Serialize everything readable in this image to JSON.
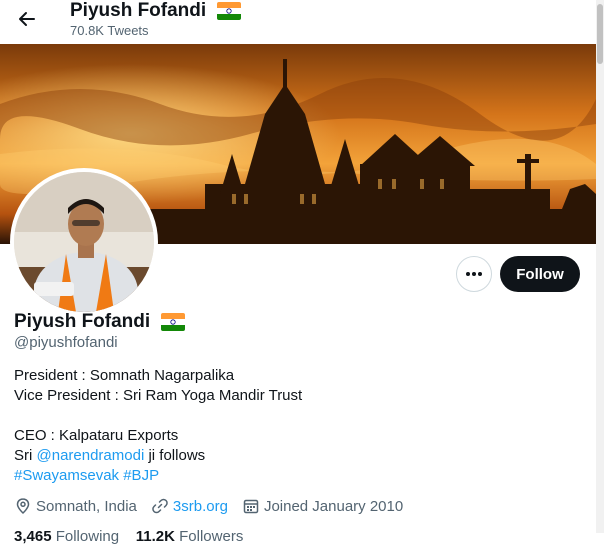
{
  "header": {
    "name": "Piyush Fofandi",
    "tweet_count": "70.8K Tweets"
  },
  "profile": {
    "display_name": "Piyush Fofandi",
    "handle": "@piyushfofandi",
    "follow_label": "Follow",
    "bio": {
      "line1": "President : Somnath Nagarpalika",
      "line2": "Vice President : Sri Ram Yoga Mandir Trust",
      "line4": "CEO : Kalpataru Exports",
      "line5_prefix": "Sri ",
      "line5_mention": "@narendramodi",
      "line5_suffix": " ji follows",
      "hashtag1": "#Swayamsevak",
      "hashtag2": "#BJP"
    },
    "location": "Somnath, India",
    "website": "3srb.org",
    "joined": "Joined January 2010",
    "following_count": "3,465",
    "following_label": "Following",
    "followers_count": "11.2K",
    "followers_label": "Followers"
  },
  "icons": {
    "back": "arrow-left-icon",
    "more": "more-horizontal-icon",
    "location": "location-pin-icon",
    "link": "link-icon",
    "calendar": "calendar-icon",
    "flag": "india-flag-icon"
  },
  "colors": {
    "accent": "#1d9bf0",
    "follow_button": "#0f1419",
    "secondary_text": "#536471",
    "banner_sky": "#e08a1e"
  }
}
